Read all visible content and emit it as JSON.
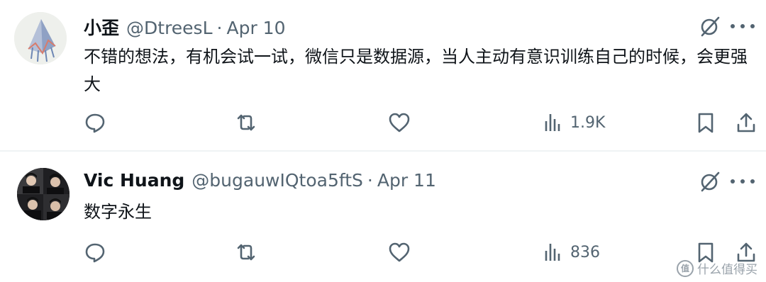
{
  "tweets": [
    {
      "name": "小歪",
      "handle": "@DtreesL",
      "separator": "·",
      "date": "Apr 10",
      "text": "不错的想法，有机会试一试，微信只是数据源，当人主动有意识训练自己的时候，会更强大",
      "views": "1.9K",
      "avatar_icon": "kite-avatar"
    },
    {
      "name": "Vic Huang",
      "handle": "@bugauwIQtoa5ftS",
      "separator": "·",
      "date": "Apr 11",
      "text": "数字永生",
      "views": "836",
      "avatar_icon": "group-photo-avatar"
    }
  ],
  "watermark": {
    "logo": "值",
    "text": "什么值得买"
  },
  "icons": [
    "grok-icon",
    "more-icon",
    "reply-icon",
    "repost-icon",
    "like-icon",
    "views-icon",
    "bookmark-icon",
    "share-icon"
  ],
  "colors": {
    "text": "#0f1419",
    "secondary": "#536471",
    "divider": "#eff3f4",
    "background": "#ffffff"
  }
}
